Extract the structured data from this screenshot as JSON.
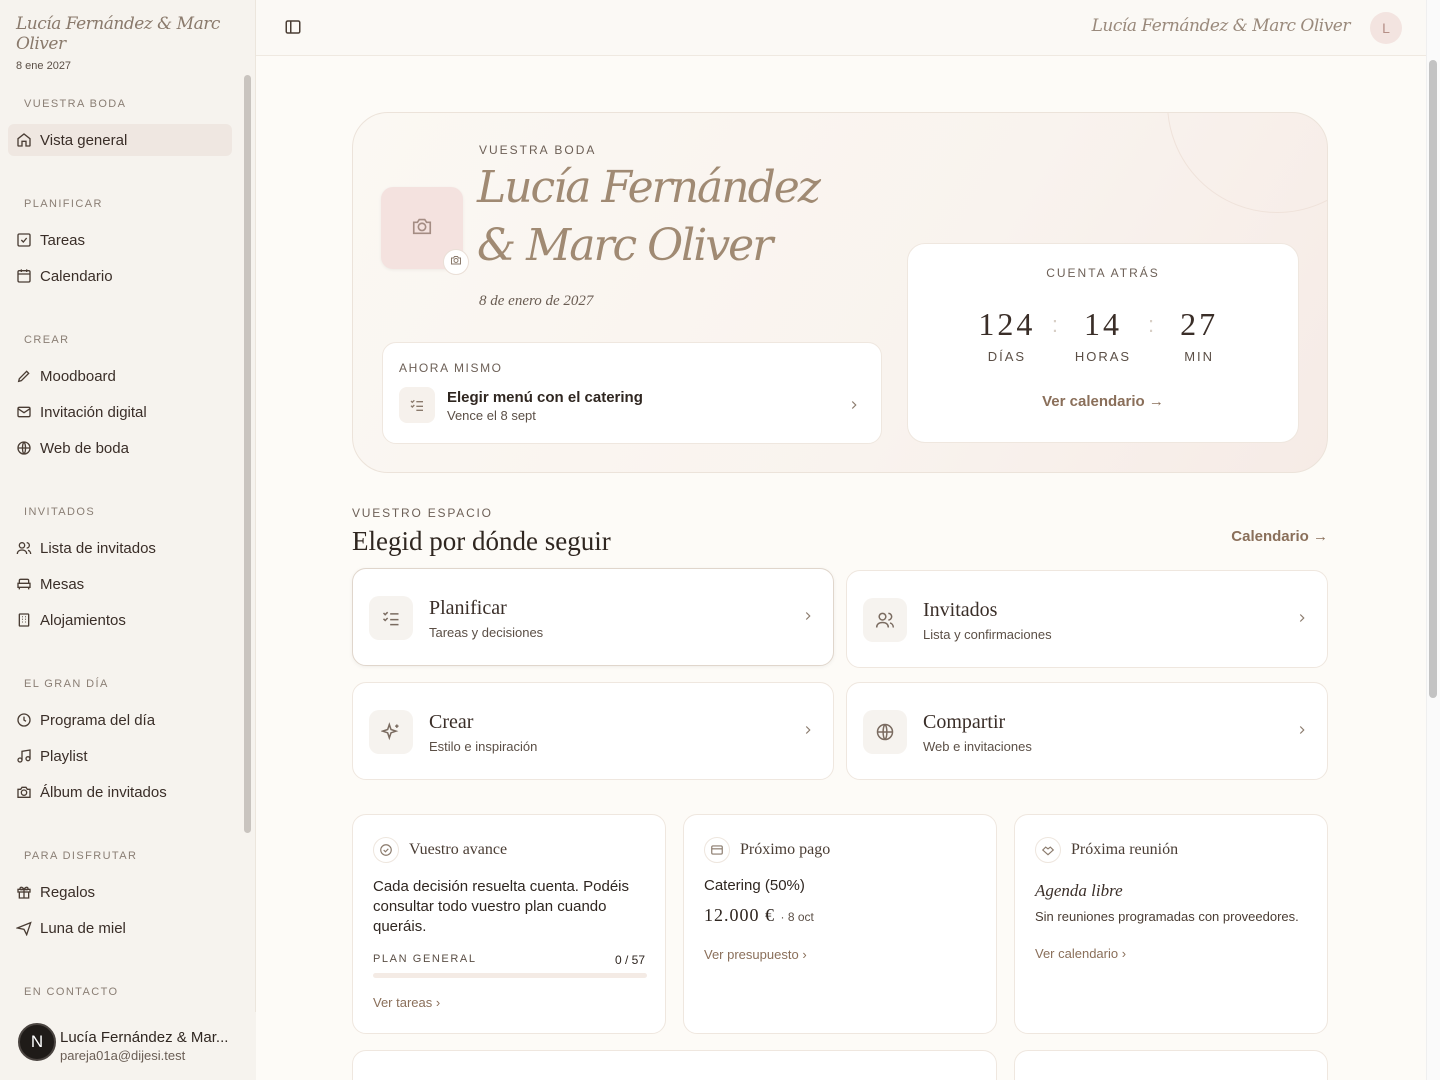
{
  "brand": {
    "name": "Lucía Fernández & Marc Oliver",
    "date": "8 ene 2027"
  },
  "sidebar": {
    "sections": [
      {
        "label": "VUESTRA BODA",
        "items": [
          {
            "label": "Vista general",
            "icon": "home-icon"
          }
        ]
      },
      {
        "label": "PLANIFICAR",
        "items": [
          {
            "label": "Tareas",
            "icon": "checkbox-icon"
          },
          {
            "label": "Calendario",
            "icon": "calendar-icon"
          }
        ]
      },
      {
        "label": "CREAR",
        "items": [
          {
            "label": "Moodboard",
            "icon": "pencil-icon"
          },
          {
            "label": "Invitación digital",
            "icon": "mail-icon"
          },
          {
            "label": "Web de boda",
            "icon": "globe-icon"
          }
        ]
      },
      {
        "label": "INVITADOS",
        "items": [
          {
            "label": "Lista de invitados",
            "icon": "users-icon"
          },
          {
            "label": "Mesas",
            "icon": "sofa-icon"
          },
          {
            "label": "Alojamientos",
            "icon": "building-icon"
          }
        ]
      },
      {
        "label": "EL GRAN DÍA",
        "items": [
          {
            "label": "Programa del día",
            "icon": "clock-icon"
          },
          {
            "label": "Playlist",
            "icon": "music-icon"
          },
          {
            "label": "Álbum de invitados",
            "icon": "camera-icon"
          }
        ]
      },
      {
        "label": "PARA DISFRUTAR",
        "items": [
          {
            "label": "Regalos",
            "icon": "gift-icon"
          },
          {
            "label": "Luna de miel",
            "icon": "plane-icon"
          }
        ]
      },
      {
        "label": "EN CONTACTO",
        "items": []
      }
    ],
    "user": {
      "initial": "N",
      "name": "Lucía Fernández & Mar...",
      "email": "pareja01a@dijesi.test"
    }
  },
  "topbar": {
    "name": "Lucía Fernández & Marc Oliver",
    "avatar": "L"
  },
  "hero": {
    "eyebrow": "VUESTRA BODA",
    "title": "Lucía Fernández & Marc Oliver",
    "date": "8 de enero de 2027",
    "now": {
      "eyebrow": "AHORA MISMO",
      "title": "Elegir menú con el catering",
      "sub": "Vence el 8 sept"
    },
    "countdown": {
      "eyebrow": "CUENTA ATRÁS",
      "days": "124",
      "days_label": "DÍAS",
      "hours": "14",
      "hours_label": "HORAS",
      "mins": "27",
      "mins_label": "MIN",
      "link": "Ver calendario"
    }
  },
  "space": {
    "eyebrow": "VUESTRO ESPACIO",
    "title": "Elegid por dónde seguir",
    "link": "Calendario",
    "cards": [
      {
        "title": "Planificar",
        "sub": "Tareas y decisiones"
      },
      {
        "title": "Invitados",
        "sub": "Lista y confirmaciones"
      },
      {
        "title": "Crear",
        "sub": "Estilo e inspiración"
      },
      {
        "title": "Compartir",
        "sub": "Web e invitaciones"
      }
    ]
  },
  "progress": {
    "title": "Vuestro avance",
    "body": "Cada decisión resuelta cuenta. Podéis consultar todo vuestro plan cuando queráis.",
    "plan_label": "PLAN GENERAL",
    "done": 0,
    "total": 57,
    "count_text": "0 / 57",
    "link": "Ver tareas"
  },
  "payment": {
    "title": "Próximo pago",
    "name": "Catering (50%)",
    "amount": "12.000 €",
    "date": "· 8 oct",
    "link": "Ver presupuesto"
  },
  "meeting": {
    "title": "Próxima reunión",
    "headline": "Agenda libre",
    "sub": "Sin reuniones programadas con proveedores.",
    "link": "Ver calendario"
  }
}
